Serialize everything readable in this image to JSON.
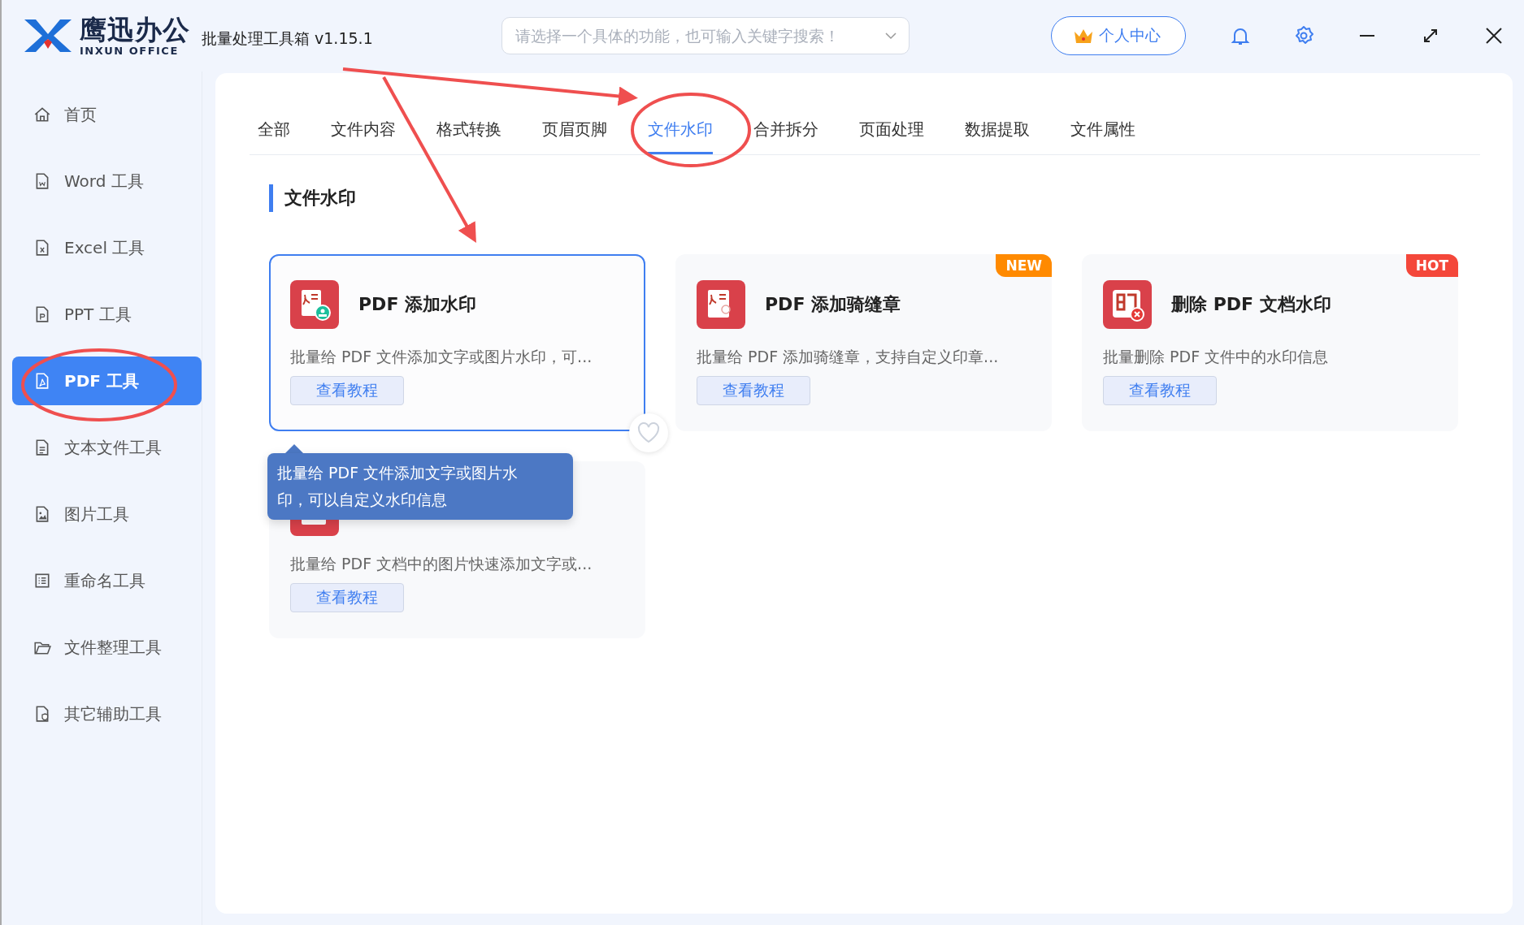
{
  "app": {
    "logo_text": "鹰迅办公",
    "logo_subtext": "INXUN OFFICE",
    "title": "批量处理工具箱 v1.15.1"
  },
  "search": {
    "placeholder": "请选择一个具体的功能，也可输入关键字搜索！"
  },
  "user_button": "个人中心",
  "sidebar": {
    "items": [
      {
        "label": "首页",
        "kind": "home",
        "selected": false
      },
      {
        "label": "Word 工具",
        "kind": "word",
        "selected": false
      },
      {
        "label": "Excel 工具",
        "kind": "excel",
        "selected": false
      },
      {
        "label": "PPT 工具",
        "kind": "ppt",
        "selected": false
      },
      {
        "label": "PDF 工具",
        "kind": "pdf",
        "selected": true
      },
      {
        "label": "文本文件工具",
        "kind": "text",
        "selected": false
      },
      {
        "label": "图片工具",
        "kind": "image",
        "selected": false
      },
      {
        "label": "重命名工具",
        "kind": "list",
        "selected": false
      },
      {
        "label": "文件整理工具",
        "kind": "folder",
        "selected": false
      },
      {
        "label": "其它辅助工具",
        "kind": "shield",
        "selected": false
      }
    ]
  },
  "tabs": [
    {
      "label": "全部",
      "selected": false
    },
    {
      "label": "文件内容",
      "selected": false
    },
    {
      "label": "格式转换",
      "selected": false
    },
    {
      "label": "页眉页脚",
      "selected": false
    },
    {
      "label": "文件水印",
      "selected": true
    },
    {
      "label": "合并拆分",
      "selected": false
    },
    {
      "label": "页面处理",
      "selected": false
    },
    {
      "label": "数据提取",
      "selected": false
    },
    {
      "label": "文件属性",
      "selected": false
    }
  ],
  "section_title": "文件水印",
  "cards": [
    {
      "kind": "pdf-stamp",
      "title": "PDF 添加水印",
      "description": "批量给 PDF 文件添加文字或图片水印，可...",
      "button": "查看教程",
      "hovered": true
    },
    {
      "kind": "pdf-seal",
      "title": "PDF 添加骑缝章",
      "description": "批量给 PDF 添加骑缝章，支持自定义印章...",
      "button": "查看教程",
      "hovered": false,
      "badge": {
        "text": "NEW",
        "color": "#ff8a00"
      }
    },
    {
      "kind": "seal-delete",
      "title": "删除 PDF 文档水印",
      "description": "批量删除 PDF 文件中的水印信息",
      "button": "查看教程",
      "hovered": false,
      "badge": {
        "text": "HOT",
        "color": "#f4473a"
      }
    },
    {
      "kind": "image-pdf",
      "description": "批量给 PDF 文档中的图片快速添加文字或...",
      "button": "查看教程",
      "hovered": false
    }
  ],
  "tooltip": {
    "text": "批量给 PDF 文件添加文字或图片水印，可以自定义水印信息"
  }
}
